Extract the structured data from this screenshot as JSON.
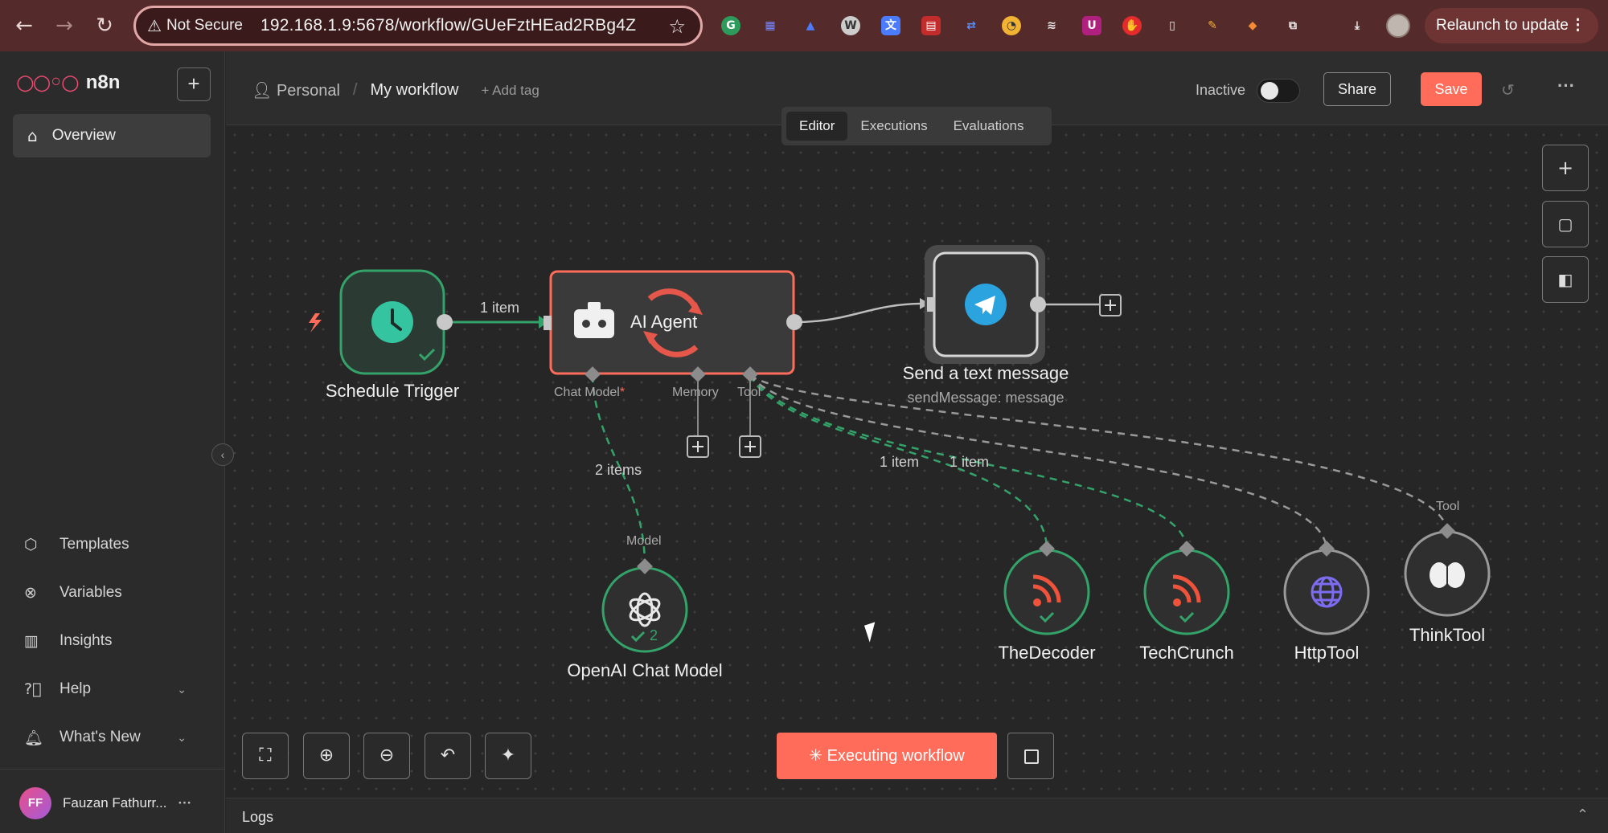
{
  "browser": {
    "security_label": "Not Secure",
    "url": "192.168.1.9:5678/workflow/GUeFztHEad2RBg4Z",
    "relaunch_label": "Relaunch to update"
  },
  "sidebar": {
    "brand": "n8n",
    "overview": "Overview",
    "items": [
      {
        "label": "Templates",
        "icon": "templates-icon"
      },
      {
        "label": "Variables",
        "icon": "variables-icon"
      },
      {
        "label": "Insights",
        "icon": "insights-icon"
      },
      {
        "label": "Help",
        "icon": "help-icon"
      },
      {
        "label": "What's New",
        "icon": "bell-icon"
      }
    ],
    "user": {
      "initials": "FF",
      "name": "Fauzan Fathurr..."
    }
  },
  "header": {
    "project": "Personal",
    "workflow_name": "My workflow",
    "add_tag": "+ Add tag",
    "status": "Inactive",
    "share": "Share",
    "save": "Save",
    "tabs": [
      "Editor",
      "Executions",
      "Evaluations"
    ],
    "active_tab": "Editor"
  },
  "nodes": {
    "schedule": {
      "label": "Schedule Trigger"
    },
    "agent": {
      "label": "AI Agent",
      "ports": [
        "Chat Model",
        "Memory",
        "Tool"
      ],
      "required_marker": "*"
    },
    "telegram": {
      "label": "Send a text message",
      "sub": "sendMessage: message"
    },
    "openai": {
      "label": "OpenAI Chat Model",
      "port": "Model",
      "count": "2"
    },
    "decoder": {
      "label": "TheDecoder"
    },
    "techcrunch": {
      "label": "TechCrunch"
    },
    "http": {
      "label": "HttpTool"
    },
    "think": {
      "label": "ThinkTool",
      "port": "Tool"
    }
  },
  "connections": {
    "trigger_to_agent": "1 item",
    "model_items": "2 items",
    "decoder_items": "1 item",
    "techcrunch_items": "1 item"
  },
  "footer": {
    "execute_label": "Executing workflow",
    "logs_label": "Logs"
  },
  "colors": {
    "accent": "#ff6d5a",
    "success": "#34a36a",
    "running_node_border": "#ff6d5a"
  }
}
